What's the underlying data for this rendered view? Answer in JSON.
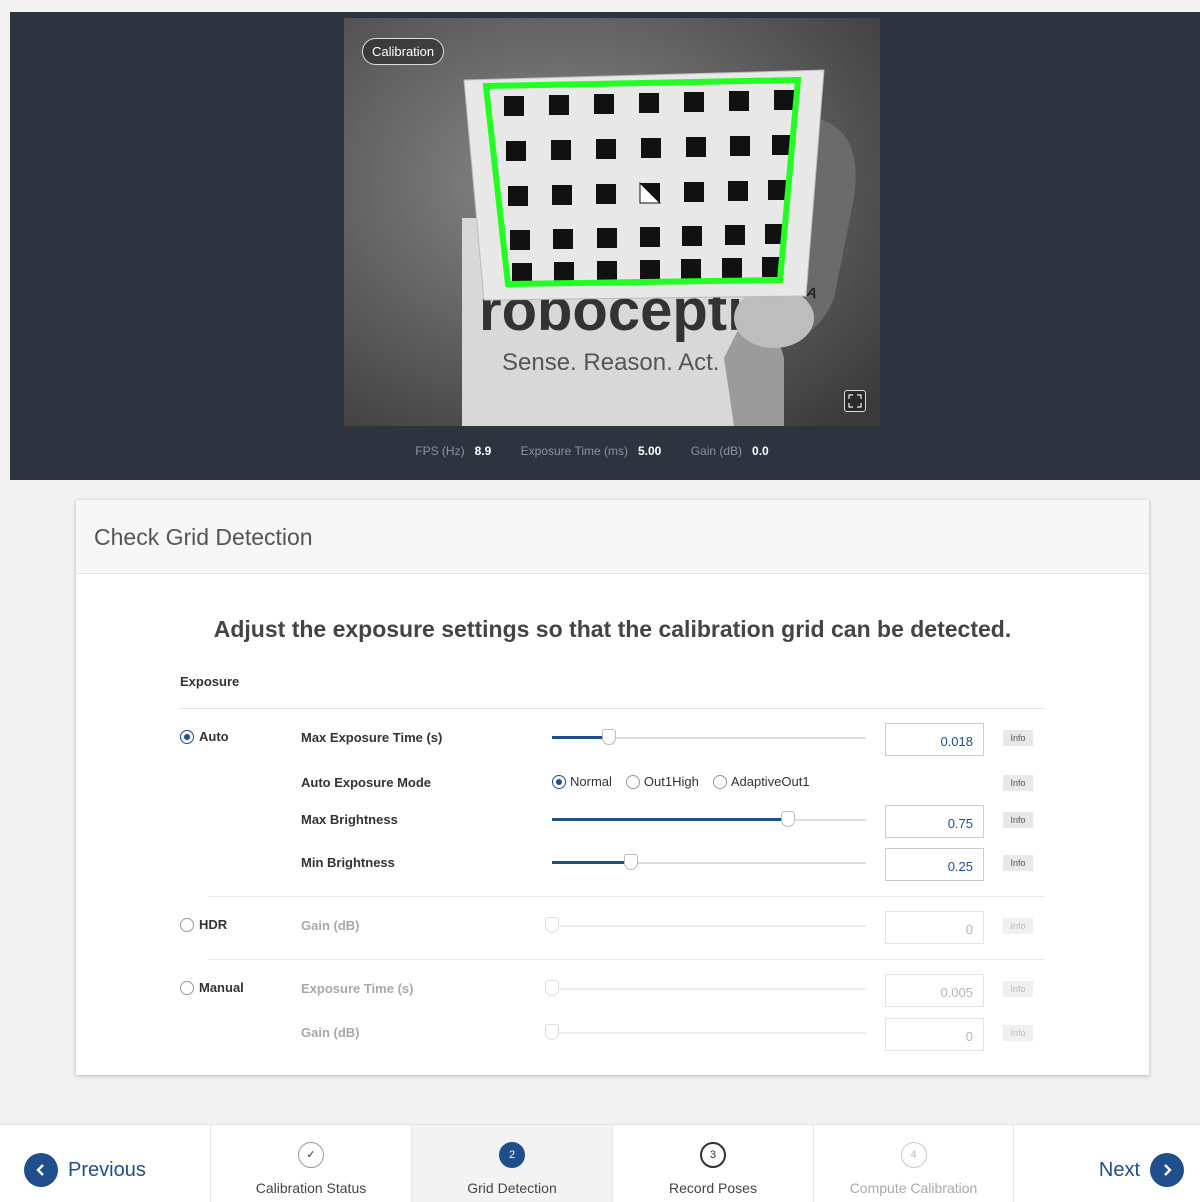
{
  "camera": {
    "badge": "Calibration",
    "stats": [
      {
        "label": "FPS (Hz)",
        "value": "8.9"
      },
      {
        "label": "Exposure Time (ms)",
        "value": "5.00"
      },
      {
        "label": "Gain (dB)",
        "value": "0.0"
      }
    ]
  },
  "card": {
    "title": "Check Grid Detection",
    "lead": "Adjust the exposure settings so that the calibration grid can be detected.",
    "section_label": "Exposure",
    "info_label": "Info",
    "auto": {
      "label": "Auto",
      "selected": true,
      "max_exposure": {
        "label": "Max Exposure Time (s)",
        "value": "0.018",
        "fraction": 0.18
      },
      "mode": {
        "label": "Auto Exposure Mode",
        "options": [
          "Normal",
          "Out1High",
          "AdaptiveOut1"
        ],
        "selected": "Normal"
      },
      "max_brightness": {
        "label": "Max Brightness",
        "value": "0.75",
        "fraction": 0.75
      },
      "min_brightness": {
        "label": "Min Brightness",
        "value": "0.25",
        "fraction": 0.25
      }
    },
    "hdr": {
      "label": "HDR",
      "selected": false,
      "gain": {
        "label": "Gain (dB)",
        "value": "0",
        "fraction": 0
      }
    },
    "manual": {
      "label": "Manual",
      "selected": false,
      "exposure": {
        "label": "Exposure Time (s)",
        "value": "0.005",
        "fraction": 0
      },
      "gain": {
        "label": "Gain (dB)",
        "value": "0",
        "fraction": 0
      }
    }
  },
  "nav": {
    "previous": "Previous",
    "next": "Next",
    "steps": [
      {
        "number": "✓",
        "label": "Calibration Status",
        "state": "done"
      },
      {
        "number": "2",
        "label": "Grid Detection",
        "state": "active"
      },
      {
        "number": "3",
        "label": "Record Poses",
        "state": "next"
      },
      {
        "number": "4",
        "label": "Compute Calibration",
        "state": "future"
      }
    ]
  },
  "colors": {
    "accent": "#1f4e8c",
    "grid_outline": "#22ff22",
    "header_bg": "#2d3440"
  }
}
